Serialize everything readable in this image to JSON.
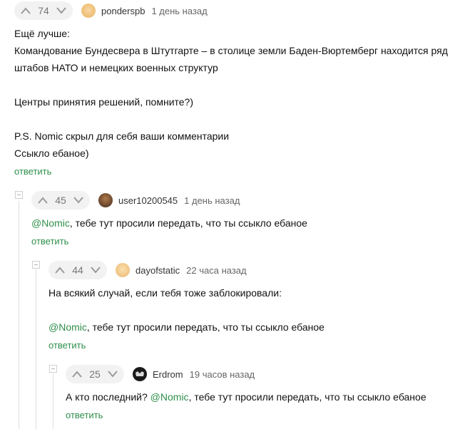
{
  "comments": [
    {
      "id": "c1",
      "rating": "74",
      "username": "ponderspb",
      "time": "1 день назад",
      "lines": [
        "Ещё лучше:",
        "Командование Бундесвера в Штутгарте – в столице земли Баден-Вюртемберг находится ряд",
        "штабов НАТО и немецких военных структур",
        "",
        "Центры принятия решений, помните?)",
        "",
        "P.S. Nomic скрыл для себя ваши комментарии",
        "Ссыкло ебаное)"
      ],
      "reply_label": "ответить"
    },
    {
      "id": "c2",
      "rating": "45",
      "username": "user10200545",
      "time": "1 день назад",
      "mention": "@Nomic",
      "text": ", тебе тут просили передать, что ты ссыкло ебаное",
      "reply_label": "ответить"
    },
    {
      "id": "c3",
      "rating": "44",
      "username": "dayofstatic",
      "time": "22 часа назад",
      "line1": "На всякий случай, если тебя тоже заблокировали:",
      "mention": "@Nomic",
      "text": ", тебе тут просили передать, что ты ссыкло ебаное",
      "reply_label": "ответить"
    },
    {
      "id": "c4",
      "rating": "25",
      "username": "Erdrom",
      "time": "19 часов назад",
      "prefix": "А кто последний? ",
      "mention": "@Nomic",
      "text": ", тебе тут просили передать, что ты ссыкло ебаное",
      "reply_label": "ответить"
    }
  ],
  "colors": {
    "accent_green": "#2f8f4c",
    "vote_bg": "#f2f2f2",
    "thread_line": "#dedede"
  },
  "icons": {
    "upvote": "up-arrow-icon",
    "downvote": "down-arrow-icon",
    "collapse": "collapse-minus-icon"
  }
}
